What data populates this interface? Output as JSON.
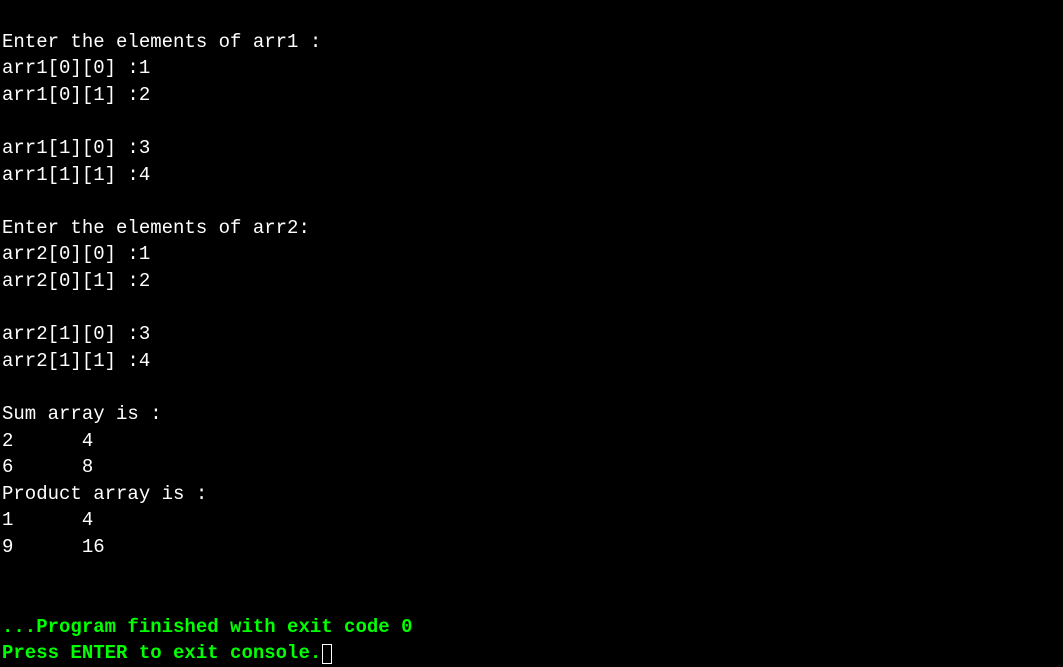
{
  "console": {
    "line1": "Enter the elements of arr1 :",
    "line2": "arr1[0][0] :1",
    "line3": "arr1[0][1] :2",
    "line4": "",
    "line5": "arr1[1][0] :3",
    "line6": "arr1[1][1] :4",
    "line7": "",
    "line8": "Enter the elements of arr2:",
    "line9": "arr2[0][0] :1",
    "line10": "arr2[0][1] :2",
    "line11": "",
    "line12": "arr2[1][0] :3",
    "line13": "arr2[1][1] :4",
    "line14": "",
    "line15": "Sum array is :",
    "line16": "2      4      ",
    "line17": "6      8      ",
    "line18": "Product array is :",
    "line19": "1      4      ",
    "line20": "9      16     ",
    "line21": "",
    "line22": "",
    "line23": "...Program finished with exit code 0",
    "line24": "Press ENTER to exit console."
  },
  "program_data": {
    "arr1": [
      [
        1,
        2
      ],
      [
        3,
        4
      ]
    ],
    "arr2": [
      [
        1,
        2
      ],
      [
        3,
        4
      ]
    ],
    "sum_array": [
      [
        2,
        4
      ],
      [
        6,
        8
      ]
    ],
    "product_array": [
      [
        1,
        4
      ],
      [
        9,
        16
      ]
    ],
    "exit_code": 0
  }
}
